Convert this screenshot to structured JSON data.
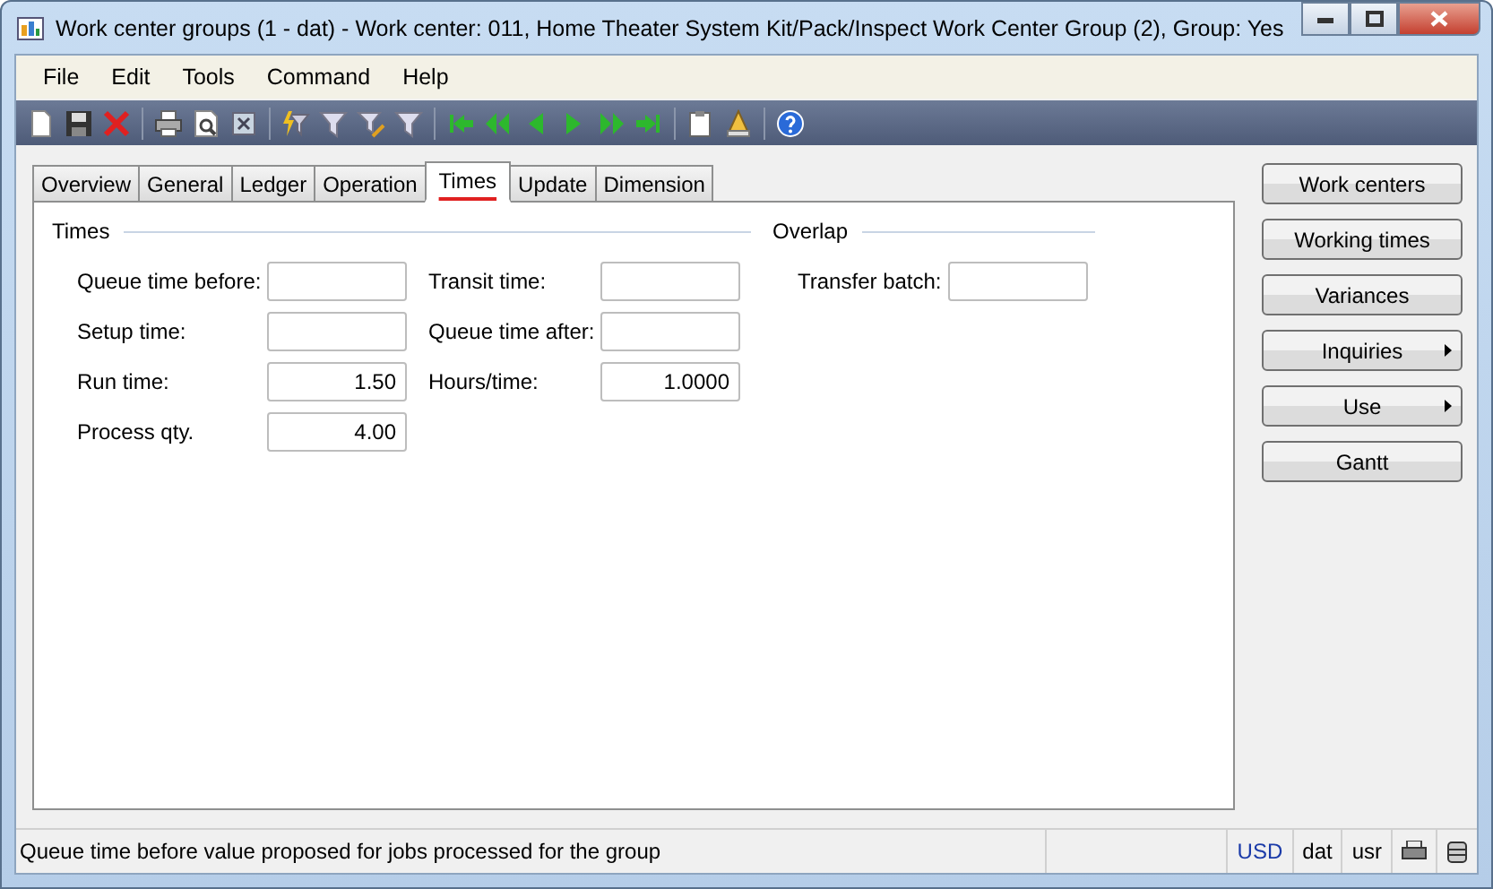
{
  "window": {
    "title": "Work center groups (1 - dat) - Work center: 011, Home Theater System Kit/Pack/Inspect Work Center Group (2), Group: Yes"
  },
  "menu": [
    "File",
    "Edit",
    "Tools",
    "Command",
    "Help"
  ],
  "tabs": [
    {
      "label": "Overview",
      "selected": false
    },
    {
      "label": "General",
      "selected": false
    },
    {
      "label": "Ledger",
      "selected": false
    },
    {
      "label": "Operation",
      "selected": false
    },
    {
      "label": "Times",
      "selected": true
    },
    {
      "label": "Update",
      "selected": false
    },
    {
      "label": "Dimension",
      "selected": false
    }
  ],
  "groups": [
    {
      "title": "Times",
      "columns": [
        [
          {
            "label": "Queue time before:"
          },
          {
            "label": "Setup time:"
          },
          {
            "label": "Run time:",
            "value": "1.50"
          },
          {
            "label": "Process qty.",
            "value": "4.00"
          }
        ],
        [
          {
            "label": "Transit time:"
          },
          {
            "label": "Queue time after:"
          },
          {
            "label": "Hours/time:",
            "value": "1.0000"
          }
        ]
      ]
    },
    {
      "title": "Overlap",
      "columns": [
        [
          {
            "label": "Transfer batch:"
          }
        ]
      ]
    }
  ],
  "buttons": [
    {
      "label": "Work centers",
      "has_menu": false
    },
    {
      "label": "Working times",
      "has_menu": false
    },
    {
      "label": "Variances",
      "has_menu": false
    },
    {
      "label": "Inquiries",
      "has_menu": true
    },
    {
      "label": "Use",
      "has_menu": true
    },
    {
      "label": "Gantt",
      "has_menu": false
    }
  ],
  "status_bar": {
    "message": "Queue time before value proposed for jobs processed for the group",
    "currency": "USD",
    "company": "dat",
    "user": "usr"
  }
}
